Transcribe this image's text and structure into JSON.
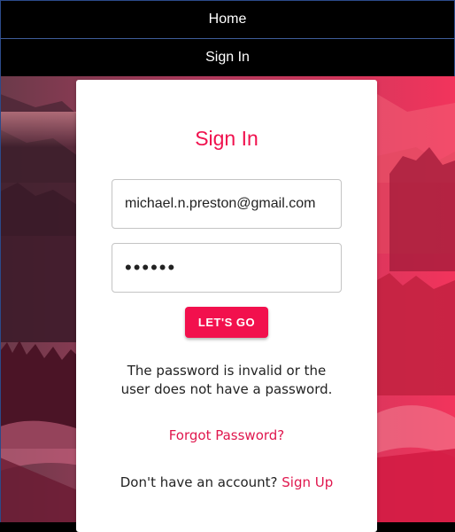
{
  "nav": {
    "home_label": "Home",
    "signin_label": "Sign In"
  },
  "form": {
    "title": "Sign In",
    "email_value": "michael.n.preston@gmail.com",
    "password_value": "••••••",
    "submit_label": "LET'S GO",
    "error_message": "The password is invalid or the user does not have a password.",
    "forgot_label": "Forgot Password?",
    "signup_prompt": "Don't have an account?",
    "signup_label": "Sign Up"
  },
  "colors": {
    "accent": "#f2104d",
    "nav_bg": "#000000"
  }
}
